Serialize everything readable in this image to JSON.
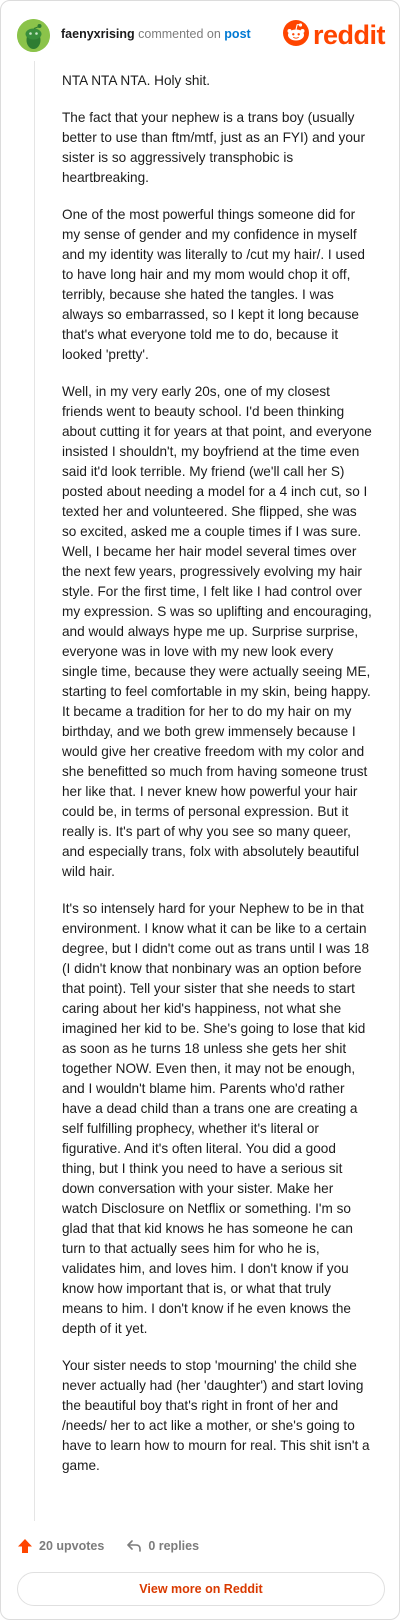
{
  "header": {
    "username": "faenyxrising",
    "verb": "commented on",
    "post_link": "post",
    "brand": "reddit"
  },
  "comment": {
    "paragraphs": [
      "NTA NTA NTA. Holy shit.",
      "The fact that your nephew is a trans boy (usually better to use than ftm/mtf, just as an FYI) and your sister is so aggressively transphobic is heartbreaking.",
      "One of the most powerful things someone did for my sense of gender and my confidence in myself and my identity was literally to /cut my hair/. I used to have long hair and my mom would chop it off, terribly, because she hated the tangles. I was always so embarrassed, so I kept it long because that's what everyone told me to do, because it looked 'pretty'.",
      "Well, in my very early 20s, one of my closest friends went to beauty school. I'd been thinking about cutting it for years at that point, and everyone insisted I shouldn't, my boyfriend at the time even said it'd look terrible. My friend (we'll call her S) posted about needing a model for a 4 inch cut, so I texted her and volunteered. She flipped, she was so excited, asked me a couple times if I was sure. Well, I became her hair model several times over the next few years, progressively evolving my hair style. For the first time, I felt like I had control over my expression. S was so uplifting and encouraging, and would always hype me up. Surprise surprise, everyone was in love with my new look every single time, because they were actually seeing ME, starting to feel comfortable in my skin, being happy. It became a tradition for her to do my hair on my birthday, and we both grew immensely because I would give her creative freedom with my color and she benefitted so much from having someone trust her like that. I never knew how powerful your hair could be, in terms of personal expression. But it really is. It's part of why you see so many queer, and especially trans, folx with absolutely beautiful wild hair.",
      "It's so intensely hard for your Nephew to be in that environment. I know what it can be like to a certain degree, but I didn't come out as trans until I was 18 (I didn't know that nonbinary was an option before that point). Tell your sister that she needs to start caring about her kid's happiness, not what she imagined her kid to be. She's going to lose that kid as soon as he turns 18 unless she gets her shit together NOW. Even then, it may not be enough, and I wouldn't blame him. Parents who'd rather have a dead child than a trans one are creating a self fulfilling prophecy, whether it's literal or figurative. And it's often literal. You did a good thing, but I think you need to have a serious sit down conversation with your sister. Make her watch Disclosure on Netflix or something. I'm so glad that that kid knows he has someone he can turn to that actually sees him for who he is, validates him, and loves him. I don't know if you know how important that is, or what that truly means to him. I don't know if he even knows the depth of it yet.",
      "Your sister needs to stop 'mourning' the child she never actually had (her 'daughter') and start loving the beautiful boy that's right in front of her and /needs/ her to act like a mother, or she's going to have to learn how to mourn for real. This shit isn't a game."
    ]
  },
  "actions": {
    "upvotes": "20 upvotes",
    "replies": "0 replies"
  },
  "footer": {
    "view_more": "View more on Reddit"
  },
  "icons": {
    "avatar": "snoo-avatar-icon",
    "logo": "reddit-snoo-icon",
    "upvote": "upvote-arrow-icon",
    "reply": "reply-arrow-icon"
  },
  "colors": {
    "brand": "#ff4500",
    "link": "#0079d3",
    "upvote": "#ff4500",
    "view_more": "#d93a00",
    "avatar_bg": "#8bc34a"
  }
}
